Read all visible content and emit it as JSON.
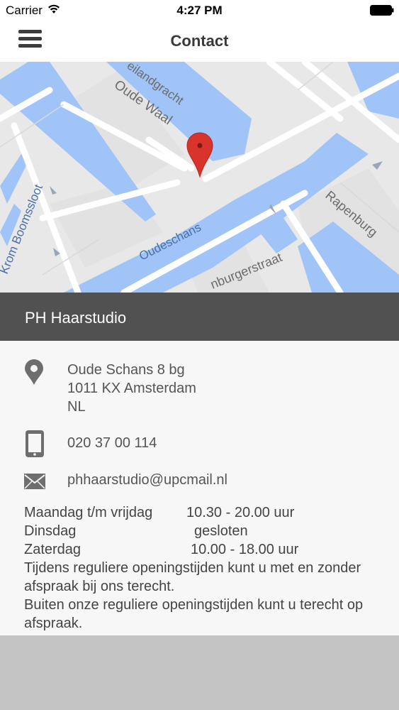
{
  "status_bar": {
    "carrier": "Carrier",
    "time": "4:27 PM"
  },
  "nav": {
    "title": "Contact",
    "menu_icon": "hamburger-menu-icon"
  },
  "map": {
    "labels": {
      "street_1": "Oude Waal",
      "street_2": "Krom Boomssloot",
      "canal_1": "Oudeschans",
      "canal_2": "eilandgracht",
      "street_3": "Rapenburg",
      "street_4": "nburgerstraat"
    },
    "colors": {
      "water": "#a0c4f8",
      "land": "#e8e8e8",
      "road": "#ffffff",
      "pin": "#d9342b"
    }
  },
  "business": {
    "name": "PH Haarstudio"
  },
  "contact": {
    "address_icon": "location-pin-icon",
    "address_line1": "Oude Schans 8  bg",
    "address_line2": "1011 KX Amsterdam",
    "address_line3": "NL",
    "phone_icon": "phone-icon",
    "phone": "020 37 00 114",
    "email_icon": "envelope-icon",
    "email": "phhaarstudio@upcmail.nl"
  },
  "hours": {
    "rows": [
      {
        "day": "Maandag t/m vrijdag",
        "time": "10.30 - 20.00 uur"
      },
      {
        "day": "Dinsdag",
        "time": "gesloten"
      },
      {
        "day": "Zaterdag",
        "time": "10.00 - 18.00 uur"
      }
    ],
    "note_1": "Tijdens reguliere openingstijden kunt u met en zonder afspraak bij ons terecht.",
    "note_2": "Buiten onze reguliere openingstijden kunt u terecht op afspraak."
  }
}
